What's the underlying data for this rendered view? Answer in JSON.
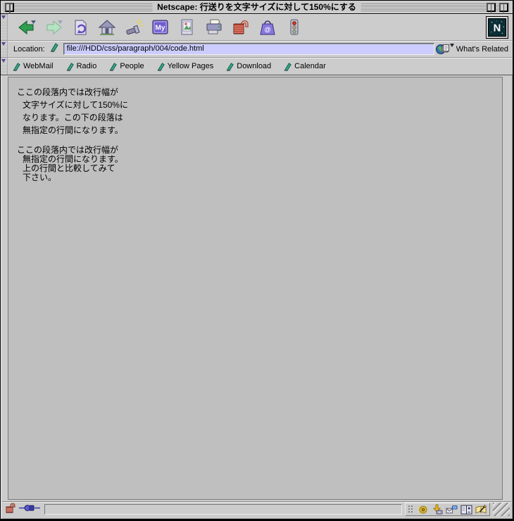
{
  "window": {
    "title": "Netscape: 行送りを文字サイズに対して150%にする"
  },
  "toolbar": {
    "icon_names": [
      "back",
      "forward",
      "reload",
      "home",
      "search",
      "my-netscape",
      "images",
      "print",
      "security",
      "shop",
      "stop"
    ],
    "my_label": "My",
    "shop_glyph": "@",
    "logo_letter": "N"
  },
  "location_bar": {
    "label": "Location:",
    "url": "file:///HDD/css/paragraph/004/code.html",
    "whats_related_label": "What's Related"
  },
  "personal_toolbar": {
    "items": [
      "WebMail",
      "Radio",
      "People",
      "Yellow Pages",
      "Download",
      "Calendar"
    ]
  },
  "content": {
    "paragraph_150": {
      "lines": [
        "ここの段落内では改行幅が",
        "文字サイズに対して150%に",
        "なります。この下の段落は",
        "無指定の行間になります。"
      ]
    },
    "paragraph_default": {
      "lines": [
        "ここの段落内では改行幅が",
        "無指定の行間になります。",
        "上の行間と比較してみて",
        "下さい。"
      ]
    }
  },
  "status_bar": {
    "message": ""
  },
  "colors": {
    "chrome": "#cccccc",
    "content_bg": "#bfbfbf",
    "url_field_bg": "#ccccff",
    "back_green": "#2f9e4f",
    "forward_green": "#b5e3c2",
    "security_red": "#bb4433",
    "shop_purple": "#8877dd"
  }
}
